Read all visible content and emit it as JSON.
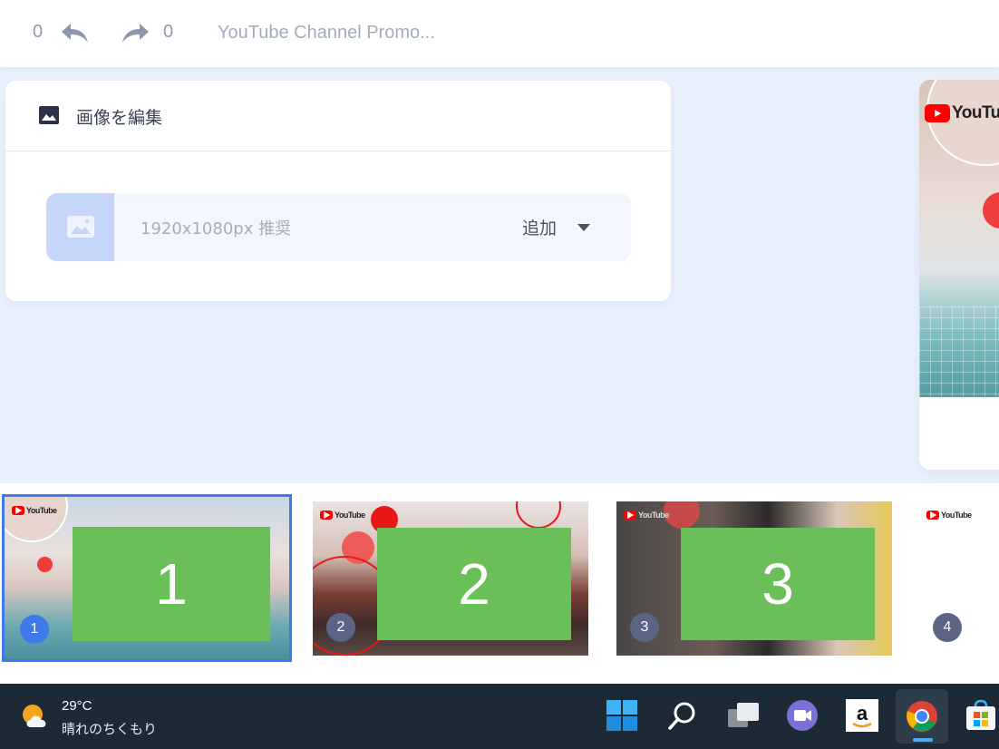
{
  "topbar": {
    "undo_count": "0",
    "redo_count": "0",
    "document_title": "YouTube Channel Promo..."
  },
  "edit_card": {
    "title": "画像を編集",
    "uploader_hint": "1920x1080px 推奨",
    "add_label": "追加"
  },
  "preview": {
    "logo_text": "YouTube"
  },
  "slides": [
    {
      "number": "1",
      "overlay": "1",
      "logo_text": "YouTube",
      "selected": true
    },
    {
      "number": "2",
      "overlay": "2",
      "logo_text": "YouTube",
      "selected": false
    },
    {
      "number": "3",
      "overlay": "3",
      "logo_text": "YouTube",
      "selected": false
    },
    {
      "number": "4",
      "overlay": "",
      "logo_text": "YouTube",
      "selected": false
    }
  ],
  "taskbar": {
    "temperature": "29°C",
    "weather_condition": "晴れのちくもり",
    "apps": [
      "windows-start-icon",
      "search-icon",
      "task-view-icon",
      "teams-chat-icon",
      "amazon-icon",
      "chrome-icon",
      "microsoft-store-icon"
    ]
  },
  "colors": {
    "accent": "#3e7be8",
    "overlay_green": "#6bbf59",
    "taskbar": "#1c2a35",
    "youtube_red": "#ff0000"
  }
}
